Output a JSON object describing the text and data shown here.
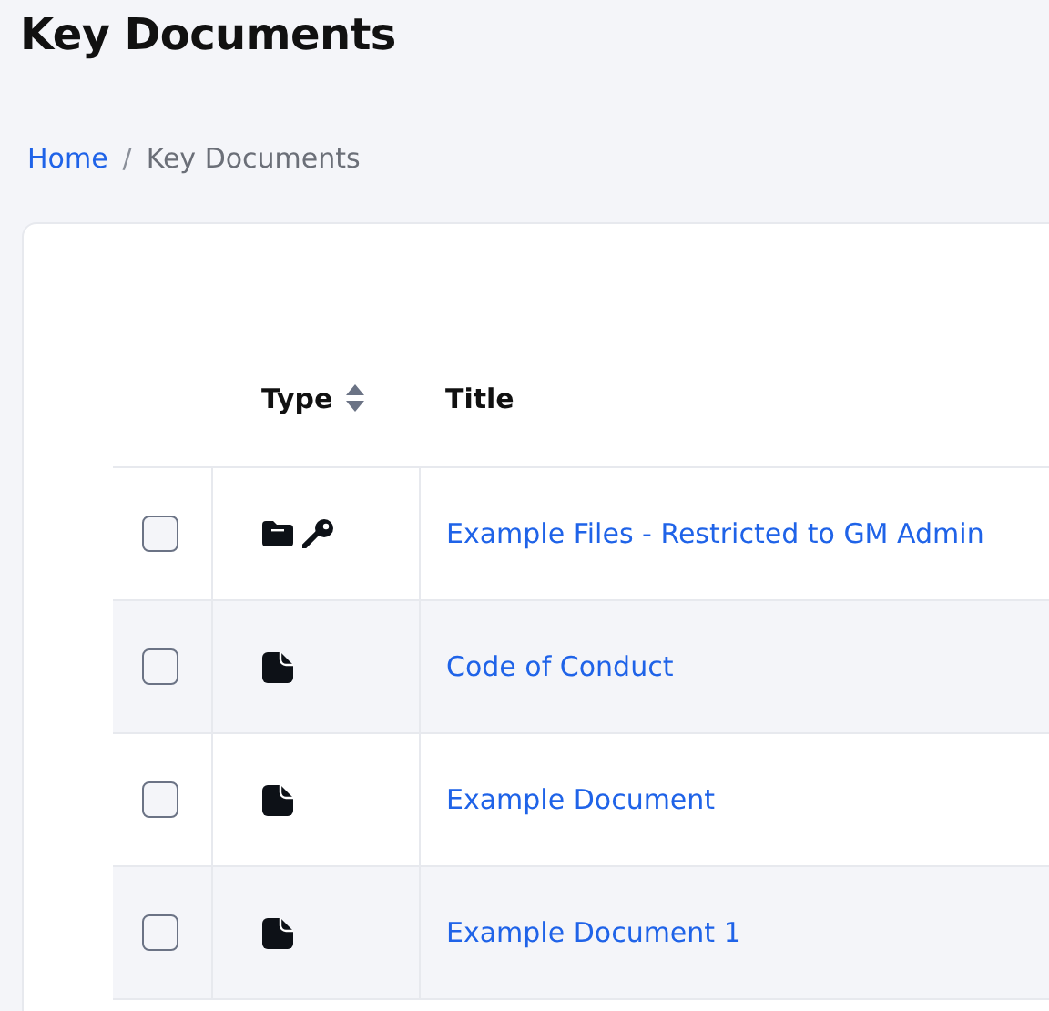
{
  "page": {
    "title": "Key Documents"
  },
  "breadcrumb": [
    {
      "label": "Home",
      "kind": "link"
    },
    {
      "label": "Key Documents",
      "kind": "current",
      "separator": "/"
    }
  ],
  "table": {
    "columns": [
      {
        "label": "Type",
        "sortable": true
      },
      {
        "label": "Title",
        "sortable": false
      }
    ],
    "rows": [
      {
        "kind": "folder",
        "locked": true,
        "checked": false,
        "title": "Example Files - Restricted to GM Admin"
      },
      {
        "kind": "document",
        "locked": false,
        "checked": false,
        "title": "Code of Conduct"
      },
      {
        "kind": "document",
        "locked": false,
        "checked": false,
        "title": "Example Document"
      },
      {
        "kind": "document",
        "locked": false,
        "checked": false,
        "title": "Example Document 1"
      }
    ]
  }
}
